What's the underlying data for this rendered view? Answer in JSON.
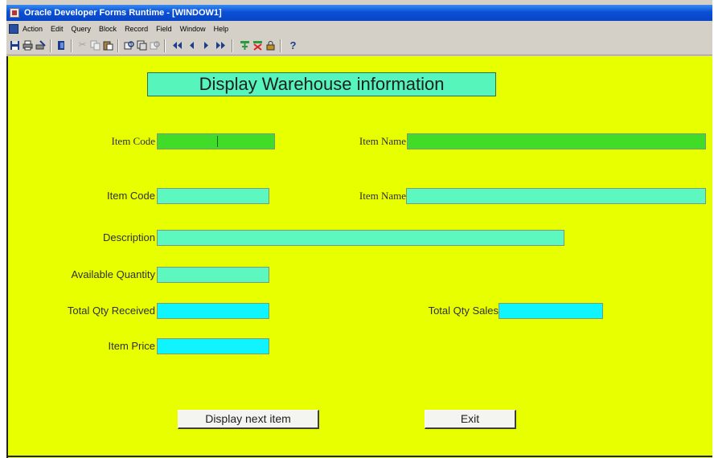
{
  "window": {
    "title": "Oracle Developer Forms Runtime - [WINDOW1]"
  },
  "menu": [
    "Action",
    "Edit",
    "Query",
    "Block",
    "Record",
    "Field",
    "Window",
    "Help"
  ],
  "toolbar": {
    "icons": [
      "save-icon",
      "print-icon",
      "print-setup-icon",
      "exit-icon",
      "cut-icon",
      "copy-icon",
      "paste-icon",
      "enter-query-icon",
      "execute-query-icon",
      "cancel-query-icon",
      "first-record-icon",
      "previous-record-icon",
      "next-record-icon",
      "last-record-icon",
      "insert-record-icon",
      "delete-record-icon",
      "lock-record-icon",
      "help-icon"
    ],
    "help_glyph": "?"
  },
  "form": {
    "heading": "Display Warehouse information",
    "labels": {
      "item_code_1": "Item Code",
      "item_name_1": "Item Name",
      "item_code_2": "Item Code",
      "item_name_2": "Item Name",
      "description": "Description",
      "available_quantity": "Available Quantity",
      "total_qty_received": "Total Qty Received",
      "total_qty_sales": "Total Qty Sales",
      "item_price": "Item Price"
    },
    "buttons": {
      "display_next": "Display next item",
      "exit": "Exit"
    },
    "colors": {
      "canvas": "#e8ff00",
      "field_green": "#40dc28",
      "field_mint": "#5cf8c0",
      "field_cyan": "#10f4ff"
    }
  }
}
